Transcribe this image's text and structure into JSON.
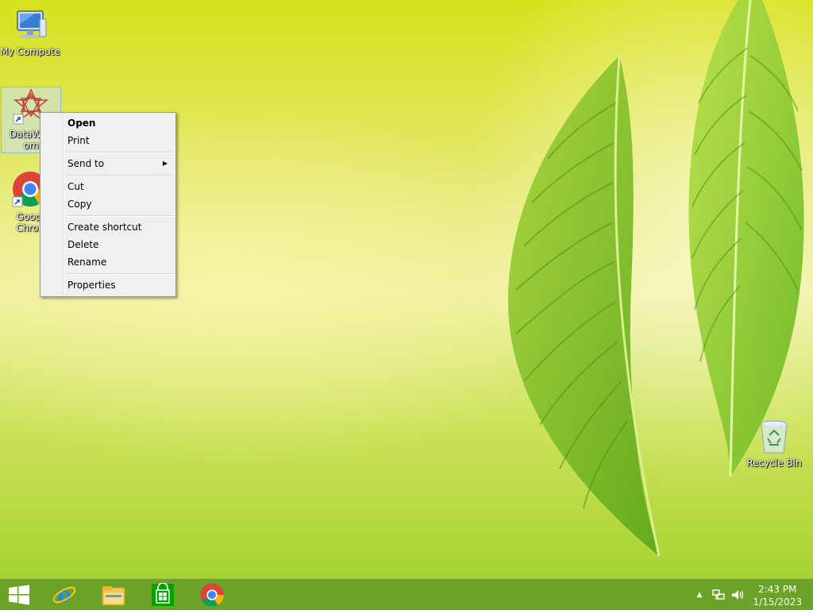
{
  "desktop": {
    "icons": [
      {
        "label": "My Computer",
        "icon": "computer-icon"
      },
      {
        "label": "DataWag",
        "label_line2": "om",
        "icon": "datawagon-app-icon"
      },
      {
        "label": "Googl",
        "label_line2": "Chron",
        "icon": "chrome-icon"
      },
      {
        "label": "Recycle Bin",
        "icon": "recycle-bin-icon"
      }
    ]
  },
  "context_menu": {
    "items": [
      {
        "label": "Open",
        "bold": true
      },
      {
        "label": "Print"
      },
      {
        "label": "Send to",
        "submenu": true
      },
      {
        "label": "Cut"
      },
      {
        "label": "Copy"
      },
      {
        "label": "Create shortcut"
      },
      {
        "label": "Delete"
      },
      {
        "label": "Rename"
      },
      {
        "label": "Properties"
      }
    ]
  },
  "taskbar": {
    "pinned": [
      "start-icon",
      "internet-explorer-icon",
      "file-explorer-icon",
      "store-icon",
      "chrome-icon"
    ],
    "tray_icons": [
      "show-hidden-icons-icon",
      "network-icon",
      "volume-icon"
    ],
    "clock": {
      "time": "2:43 PM",
      "date": "1/15/2023"
    }
  },
  "colors": {
    "taskbar": "#669e28",
    "menu_bg": "#f0f0f0",
    "selection": "#c8e1f5"
  }
}
